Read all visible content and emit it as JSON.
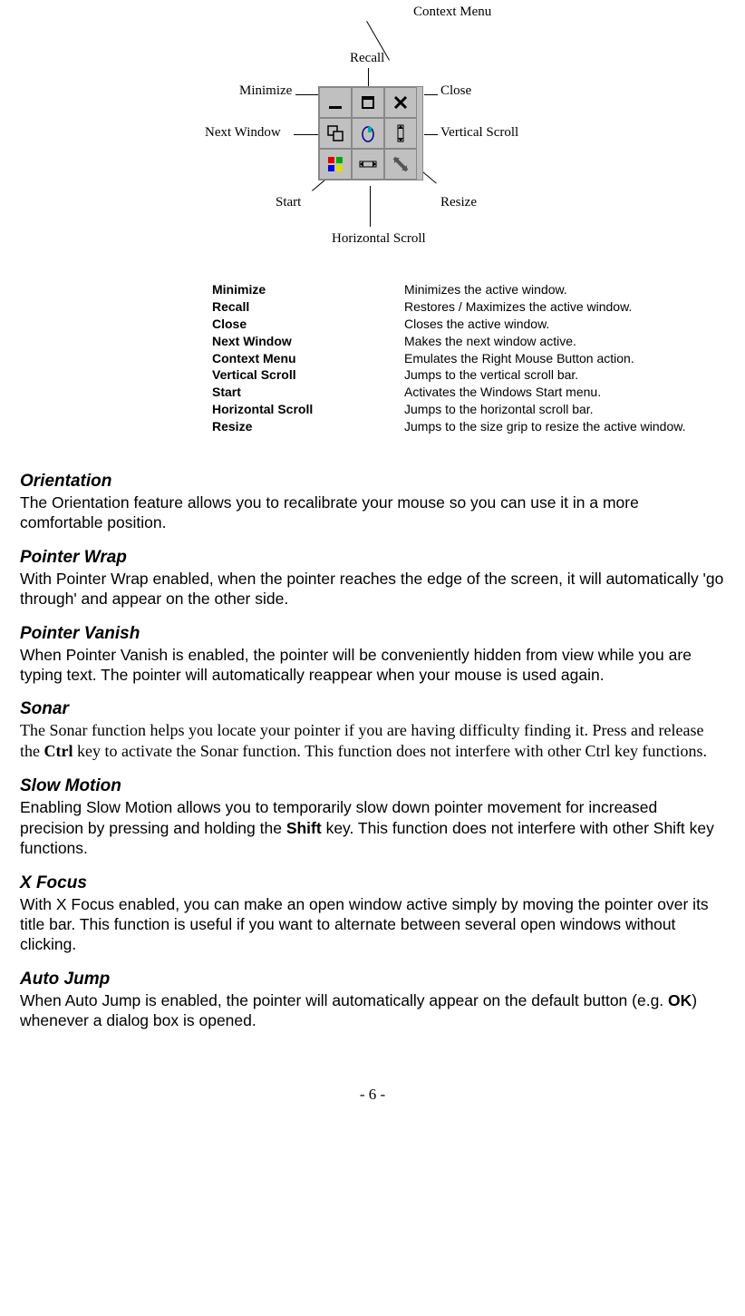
{
  "diagram": {
    "labels": {
      "context_menu": "Context Menu",
      "recall": "Recall",
      "minimize": "Minimize",
      "close": "Close",
      "next_window": "Next Window",
      "vertical_scroll": "Vertical Scroll",
      "start": "Start",
      "resize": "Resize",
      "horizontal_scroll": "Horizontal Scroll"
    }
  },
  "definitions": [
    {
      "term": "Minimize",
      "desc": "Minimizes the active window."
    },
    {
      "term": "Recall",
      "desc": "Restores / Maximizes the active window."
    },
    {
      "term": "Close",
      "desc": "Closes the active window."
    },
    {
      "term": "Next Window",
      "desc": "Makes the next window active."
    },
    {
      "term": "Context Menu",
      "desc": "Emulates the Right Mouse Button action."
    },
    {
      "term": "Vertical Scroll",
      "desc": "Jumps to the vertical scroll bar."
    },
    {
      "term": "Start",
      "desc": "Activates the Windows Start menu."
    },
    {
      "term": "Horizontal Scroll",
      "desc": "Jumps to the horizontal scroll bar."
    },
    {
      "term": "Resize",
      "desc": "Jumps to the size grip to resize the active window."
    }
  ],
  "sections": [
    {
      "heading": "Orientation",
      "body_html": "The Orientation feature allows you to recalibrate your mouse so you can use it in a more comfortable position.",
      "serif": false
    },
    {
      "heading": "Pointer Wrap",
      "body_html": "With Pointer Wrap enabled, when the pointer reaches the edge of the screen, it will automatically 'go through' and appear on the other side.",
      "serif": false
    },
    {
      "heading": "Pointer Vanish",
      "body_html": "When Pointer Vanish is enabled, the pointer will be conveniently hidden from view while you are typing text.  The pointer will automatically reappear when your mouse is used again.",
      "serif": false
    },
    {
      "heading": "Sonar",
      "body_html": "The Sonar function helps you locate your pointer if you are having difficulty finding it.  Press and release the <b>Ctrl</b> key to activate the Sonar function.  This function does not interfere with other Ctrl key functions.",
      "serif": true
    },
    {
      "heading": "Slow Motion",
      "body_html": "Enabling Slow Motion allows you to temporarily slow down pointer movement for increased precision by pressing and holding the <b>Shift</b> key.  This function does not interfere with other Shift key functions.",
      "serif": false
    },
    {
      "heading": "X Focus",
      "body_html": "With X Focus enabled, you can make an open window active simply by moving the pointer over its title bar.  This function is useful if you want to alternate between several open windows without clicking.",
      "serif": false
    },
    {
      "heading": "Auto Jump",
      "body_html": "When Auto Jump is enabled, the pointer will automatically appear on the default button (e.g. <b>OK</b>) whenever a dialog box is opened.",
      "serif": false
    }
  ],
  "page_number": "- 6 -"
}
